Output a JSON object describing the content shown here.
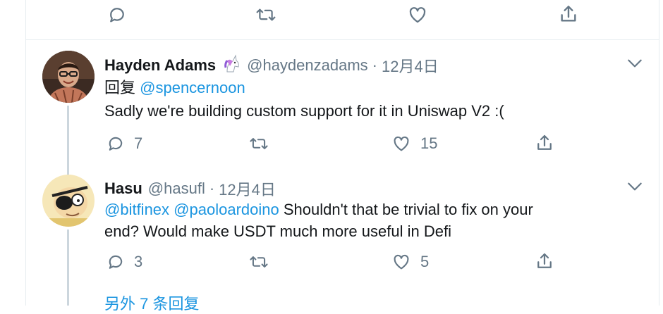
{
  "top_actions": {
    "reply": "",
    "retweet": "",
    "like": "",
    "share": ""
  },
  "tweets": [
    {
      "name": "Hayden Adams",
      "badge_icon": "unicorn-emoji",
      "handle": "@haydenzadams",
      "dot": "·",
      "time": "12月4日",
      "reply_prefix": "回复",
      "reply_to": "@spencernoon",
      "text": "Sadly we're building custom support for it in Uniswap V2 :(",
      "reply_count": "7",
      "retweet_count": "",
      "like_count": "15"
    },
    {
      "name": "Hasu",
      "handle": "@hasufl",
      "dot": "·",
      "time": "12月4日",
      "mention1": "@bitfinex",
      "mention2": "@paoloardoino",
      "text_line1": "Shouldn't that be trivial to fix on your",
      "text_line2": "end? Would make USDT much more useful in Defi",
      "reply_count": "3",
      "retweet_count": "",
      "like_count": "5"
    }
  ],
  "more_replies": "另外 7 条回复",
  "colors": {
    "link": "#1b95e0",
    "muted": "#657786",
    "text": "#14171a",
    "line": "#ccd6dd"
  }
}
